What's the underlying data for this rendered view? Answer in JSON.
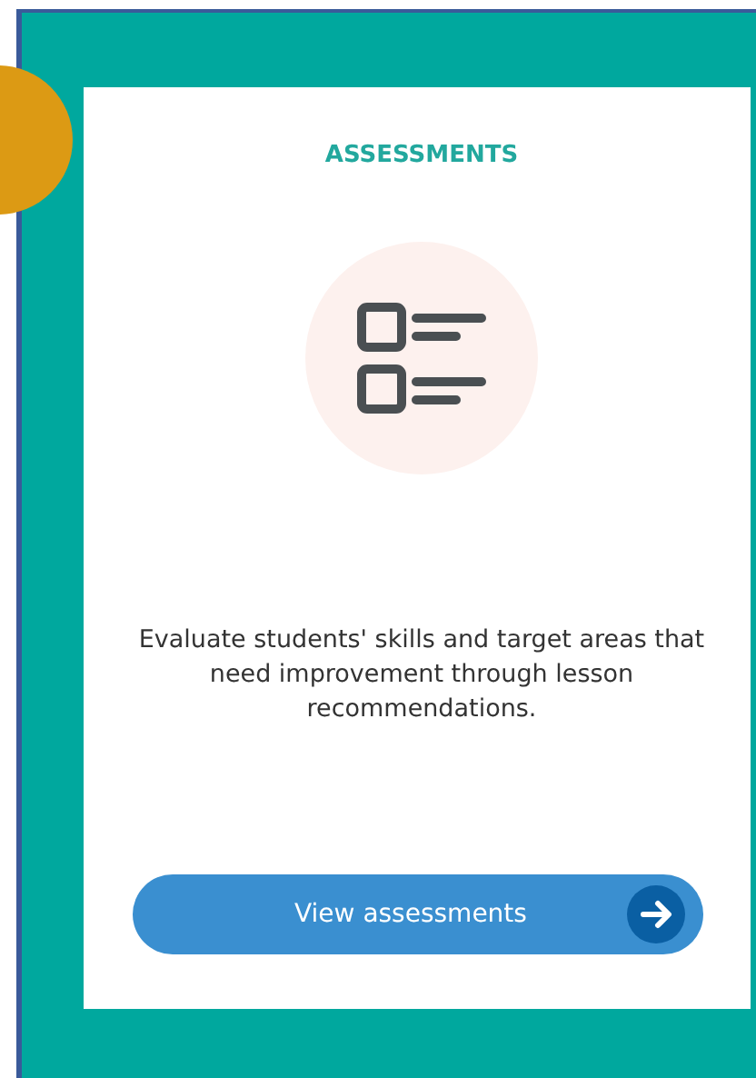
{
  "card": {
    "title": "ASSESSMENTS",
    "description": "Evaluate students' skills and target areas that need improvement through lesson recommendations.",
    "button": {
      "label": "View assessments"
    }
  }
}
